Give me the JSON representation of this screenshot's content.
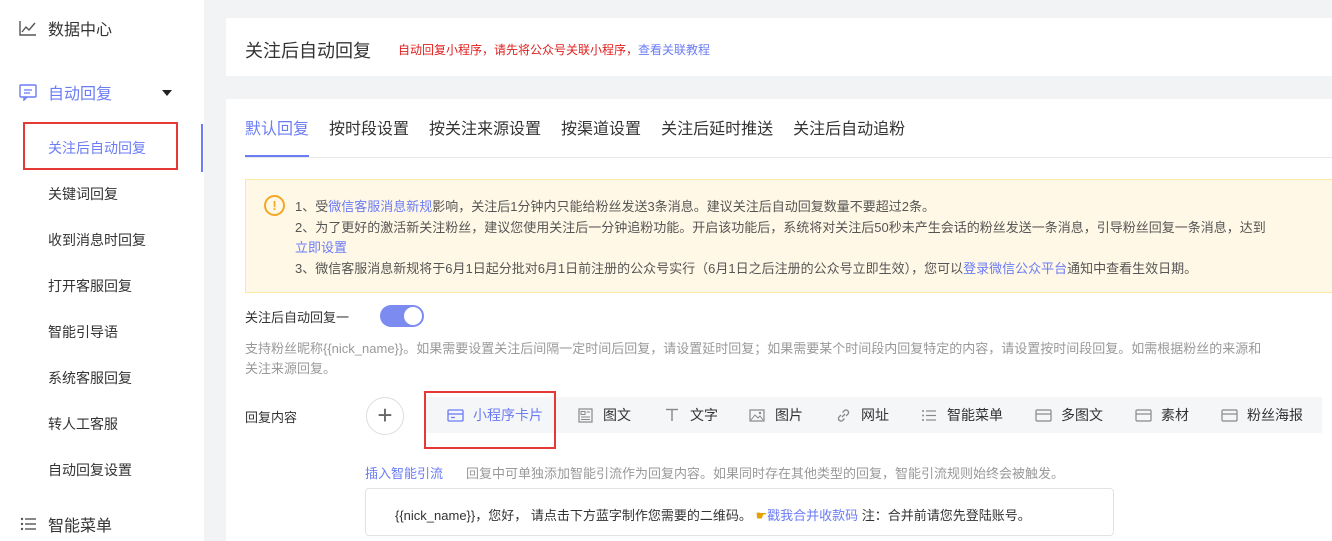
{
  "sidebar": {
    "top": {
      "label": "数据中心",
      "icon": "chart-line-icon"
    },
    "group": {
      "label": "自动回复",
      "icon": "message-square-icon"
    },
    "items": [
      {
        "label": "关注后自动回复"
      },
      {
        "label": "关键词回复"
      },
      {
        "label": "收到消息时回复"
      },
      {
        "label": "打开客服回复"
      },
      {
        "label": "智能引导语"
      },
      {
        "label": "系统客服回复"
      },
      {
        "label": "转人工客服"
      },
      {
        "label": "自动回复设置"
      }
    ],
    "bottom": {
      "label": "智能菜单",
      "icon": "list-icon"
    }
  },
  "header": {
    "title": "关注后自动回复",
    "note": "自动回复小程序，请先将公众号关联小程序，",
    "note_link": "查看关联教程"
  },
  "tabs": [
    "默认回复",
    "按时段设置",
    "按关注来源设置",
    "按渠道设置",
    "关注后延时推送",
    "关注后自动追粉"
  ],
  "notice": {
    "l1_a": "1、受",
    "l1_link": "微信客服消息新规",
    "l1_b": "影响，关注后1分钟内只能给粉丝发送3条消息。建议关注后自动回复数量不要超过2条。",
    "l2": "2、为了更好的激活新关注粉丝，建议您使用关注后一分钟追粉功能。开启该功能后，系统将对关注后50秒未产生会话的粉丝发送一条消息，引导粉丝回复一条消息，达到",
    "l2_link": "立即设置",
    "l3_a": "3、微信客服消息新规将于6月1日起分批对6月1日前注册的公众号实行（6月1日之后注册的公众号立即生效），您可以",
    "l3_link": "登录微信公众平台",
    "l3_b": "通知中查看生效日期。"
  },
  "toggle": {
    "label": "关注后自动回复一"
  },
  "hint": {
    "l1": "支持粉丝昵称{{nick_name}}。如果需要设置关注后间隔一定时间后回复，请设置延时回复；如果需要某个时间段内回复特定的内容，请设置按时间段回复。如需根据粉丝的来源和",
    "l2": "关注来源回复。"
  },
  "reply": {
    "label": "回复内容",
    "plus": "+",
    "types": [
      {
        "label": "小程序卡片",
        "icon": "card-icon"
      },
      {
        "label": "图文",
        "icon": "article-icon"
      },
      {
        "label": "文字",
        "icon": "text-icon"
      },
      {
        "label": "图片",
        "icon": "image-icon"
      },
      {
        "label": "网址",
        "icon": "link-icon"
      },
      {
        "label": "智能菜单",
        "icon": "list-icon"
      },
      {
        "label": "多图文",
        "icon": "card-icon"
      },
      {
        "label": "素材",
        "icon": "card-icon"
      },
      {
        "label": "粉丝海报",
        "icon": "card-icon"
      }
    ],
    "smart_link": "插入智能引流",
    "smart_hint": "回复中可单独添加智能引流作为回复内容。如果同时存在其他类型的回复，智能引流规则始终会被触发。"
  },
  "message": {
    "a": "{{nick_name}}，您好， 请点击下方蓝字制作您需要的二维码。",
    "hand_icon": "pointing-hand-icon",
    "link": "戳我合并收款码",
    "b": "注：合并前请您先登陆账号。"
  },
  "colors": {
    "accent": "#6b7cf5",
    "highlight_box": "#e53935",
    "notice_bg": "#fff8e6",
    "warning": "#f5a623"
  }
}
